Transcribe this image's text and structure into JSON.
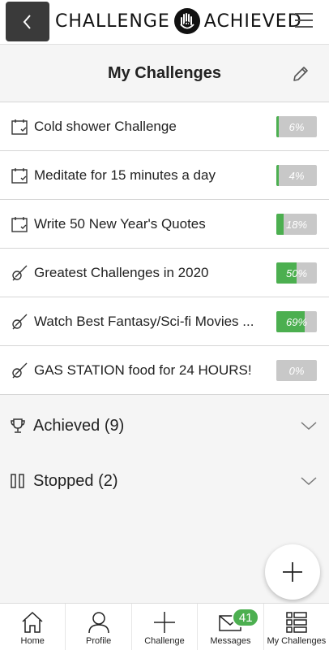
{
  "header": {
    "logo_left": "CHALLENGE",
    "logo_right": "ACHIEVED",
    "back_icon": "chevron-left-icon",
    "menu_icon": "hamburger-menu-icon"
  },
  "page": {
    "title": "My Challenges",
    "edit_icon": "pencil-icon"
  },
  "challenges": [
    {
      "label": "Cold shower Challenge",
      "progress": 6,
      "progress_text": "6%",
      "icon": "calendar-check-icon"
    },
    {
      "label": "Meditate for 15 minutes a day",
      "progress": 4,
      "progress_text": "4%",
      "icon": "calendar-check-icon"
    },
    {
      "label": "Write 50 New Year's Quotes",
      "progress": 18,
      "progress_text": "18%",
      "icon": "calendar-check-icon"
    },
    {
      "label": "Greatest Challenges in 2020",
      "progress": 50,
      "progress_text": "50%",
      "icon": "rocket-icon"
    },
    {
      "label": "Watch Best Fantasy/Sci-fi Movies ...",
      "progress": 69,
      "progress_text": "69%",
      "icon": "rocket-icon"
    },
    {
      "label": "GAS STATION food for 24 HOURS!",
      "progress": 0,
      "progress_text": "0%",
      "icon": "rocket-icon"
    }
  ],
  "sections": {
    "achieved": {
      "label": "Achieved (9)",
      "icon": "trophy-icon"
    },
    "stopped": {
      "label": "Stopped (2)",
      "icon": "pause-icon"
    }
  },
  "fab": {
    "icon": "plus-icon"
  },
  "nav": {
    "home": "Home",
    "profile": "Profile",
    "challenge": "Challenge",
    "messages": "Messages",
    "messages_badge": "41",
    "my_challenges": "My Challenges"
  },
  "colors": {
    "accent": "#4caf50",
    "progress_track": "#c8c8c8",
    "header_back": "#3a3a3a"
  }
}
